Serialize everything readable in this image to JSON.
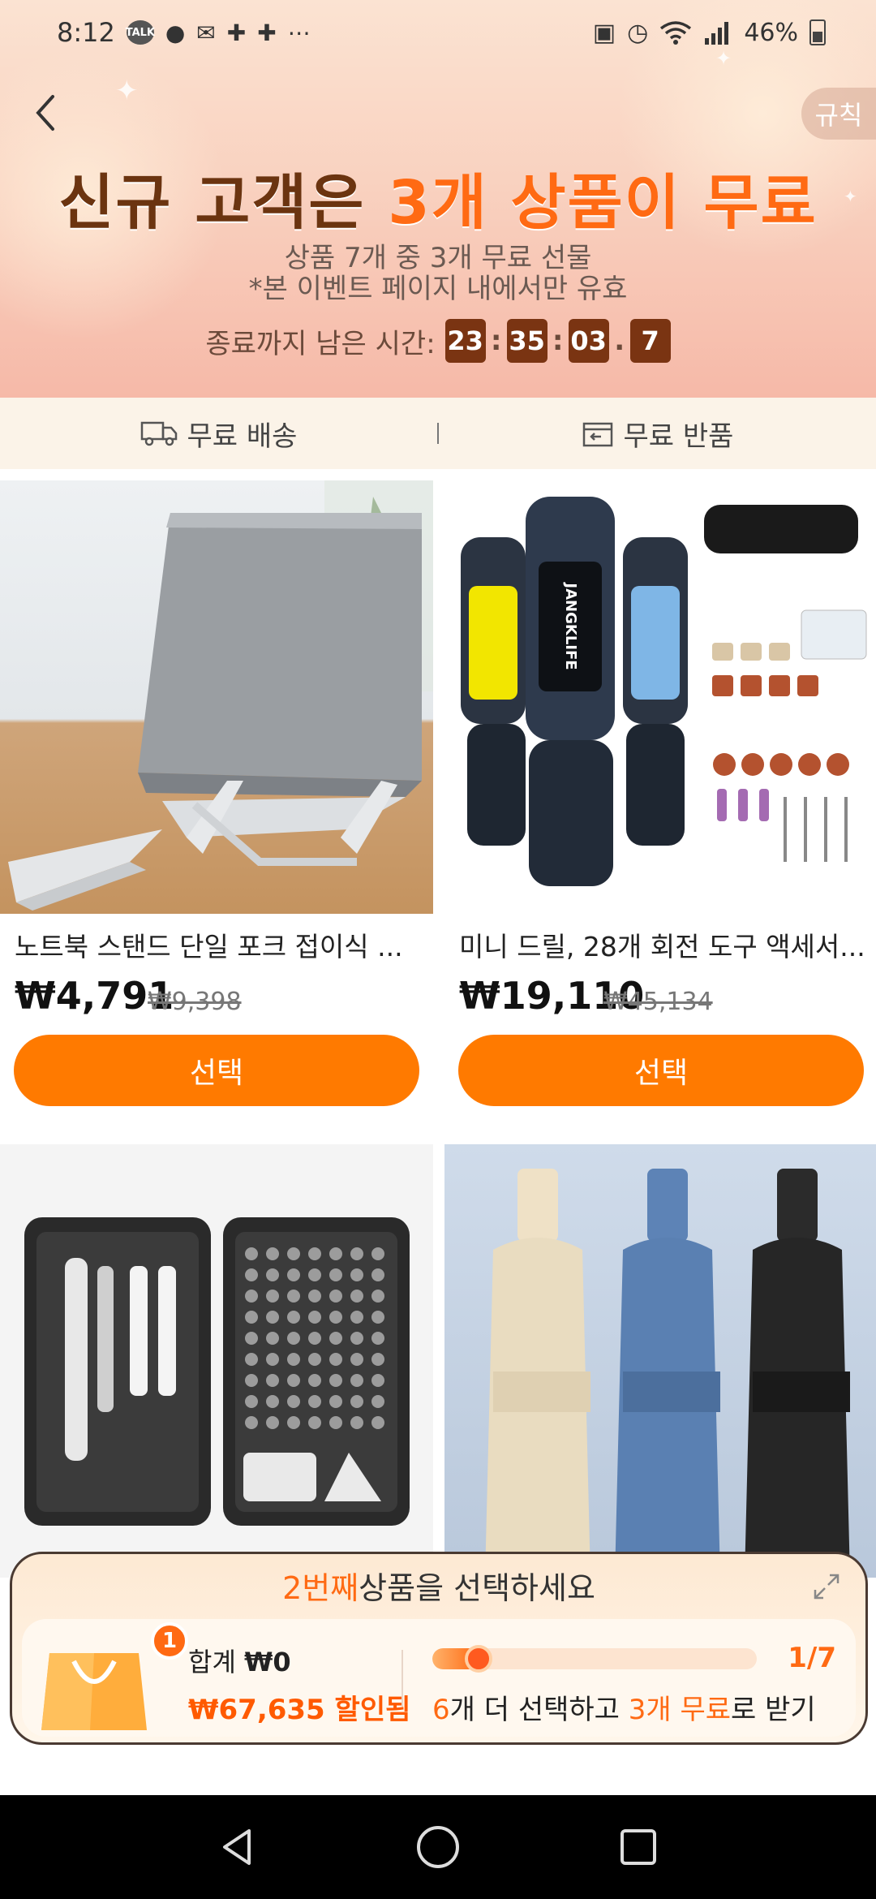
{
  "status_bar": {
    "time": "8:12",
    "talk_badge": "TALK",
    "battery": "46%"
  },
  "header": {
    "rules_label": "규칙",
    "title_part1": "신규 고객은 ",
    "title_highlight": "3개 상품이 무료",
    "subtitle_line1": "상품 7개 중 3개 무료 선물",
    "subtitle_line2": "*본 이벤트 페이지 내에서만 유효",
    "countdown_label": "종료까지 남은 시간:",
    "countdown_hours": "23",
    "countdown_minutes": "35",
    "countdown_seconds": "03",
    "countdown_tenths": "7",
    "colon": ":",
    "dot": "."
  },
  "benefits": {
    "free_shipping": "무료 배송",
    "free_return": "무료 반품"
  },
  "products": [
    {
      "name": "노트북 스탠드 단일 포크 접이식 ...",
      "price": "₩4,791",
      "old_price": "₩9,398",
      "button": "선택"
    },
    {
      "name": "미니 드릴, 28개 회전 도구 액세서...",
      "price": "₩19,110",
      "old_price": "₩45,134",
      "button": "선택"
    },
    {
      "name": "",
      "price": "",
      "old_price": "",
      "button": ""
    },
    {
      "name": "",
      "price": "",
      "old_price": "",
      "button": ""
    }
  ],
  "drill_brand": "JANGKLIFE",
  "panel": {
    "select_highlight": "2번째",
    "select_rest": " 상품을 선택하세요",
    "bag_count": "1",
    "total_label": "합계 ",
    "total_value": "₩0",
    "discount_value": "₩67,635 할인됨",
    "progress_step": "1/7",
    "progress_fraction": 0.143,
    "hint_count": "6",
    "hint_mid": "개 더 선택하고 ",
    "hint_free": "3개 무료",
    "hint_end": "로 받기"
  },
  "colors": {
    "accent": "#ff7a00",
    "countdown_bg": "#7a3412",
    "title_dark": "#6b3410"
  },
  "icons": {
    "back": "chevron-left-icon",
    "truck": "truck-icon",
    "return": "return-box-icon",
    "expand": "expand-icon",
    "nav_back": "triangle-back-icon",
    "nav_home": "circle-home-icon",
    "nav_recents": "square-recents-icon"
  }
}
